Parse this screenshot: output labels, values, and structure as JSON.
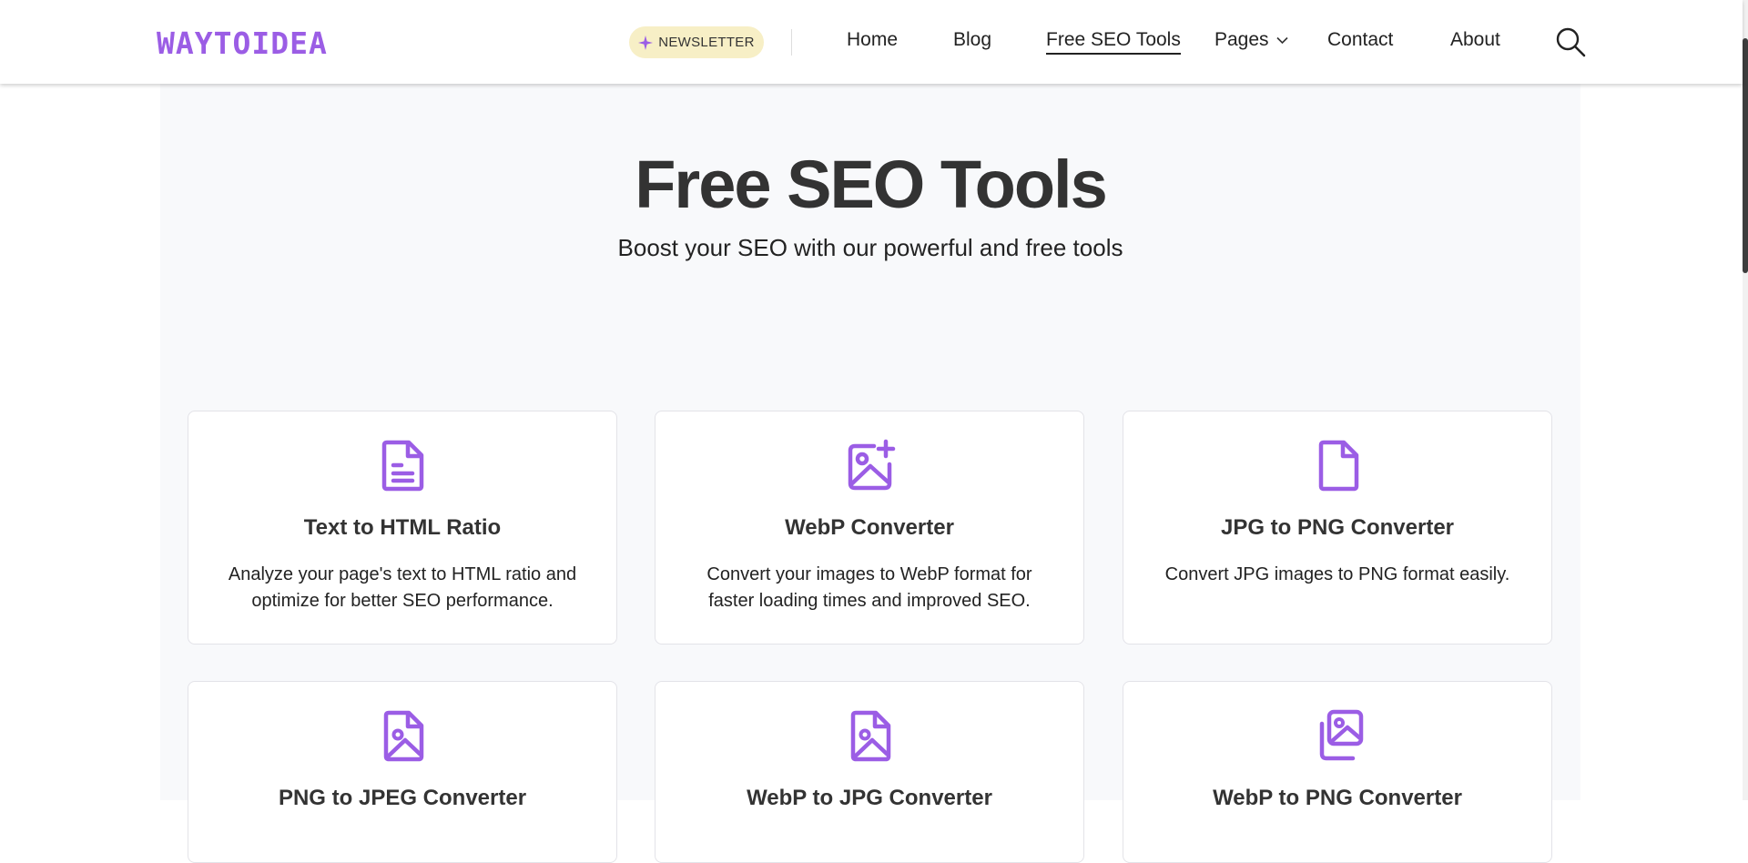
{
  "header": {
    "logo": "WAYTOIDEA",
    "newsletter_label": "NEWSLETTER",
    "nav": {
      "home": "Home",
      "blog": "Blog",
      "free_seo_tools": "Free SEO Tools",
      "pages": "Pages",
      "contact": "Contact",
      "about": "About"
    }
  },
  "hero": {
    "title": "Free SEO Tools",
    "subtitle": "Boost your SEO with our powerful and free tools"
  },
  "tools": [
    {
      "icon": "document-text-icon",
      "title": "Text to HTML Ratio",
      "description": "Analyze your page's text to HTML ratio and optimize for better SEO performance."
    },
    {
      "icon": "image-plus-icon",
      "title": "WebP Converter",
      "description": "Convert your images to WebP format for faster loading times and improved SEO."
    },
    {
      "icon": "file-icon",
      "title": "JPG to PNG Converter",
      "description": "Convert JPG images to PNG format easily."
    },
    {
      "icon": "file-image-icon",
      "title": "PNG to JPEG Converter",
      "description": ""
    },
    {
      "icon": "file-image-icon",
      "title": "WebP to JPG Converter",
      "description": ""
    },
    {
      "icon": "images-icon",
      "title": "WebP to PNG Converter",
      "description": ""
    }
  ],
  "colors": {
    "accent": "#9b5de5",
    "newsletter_bg": "#f7efc6",
    "page_bg": "#f8f9fb"
  }
}
